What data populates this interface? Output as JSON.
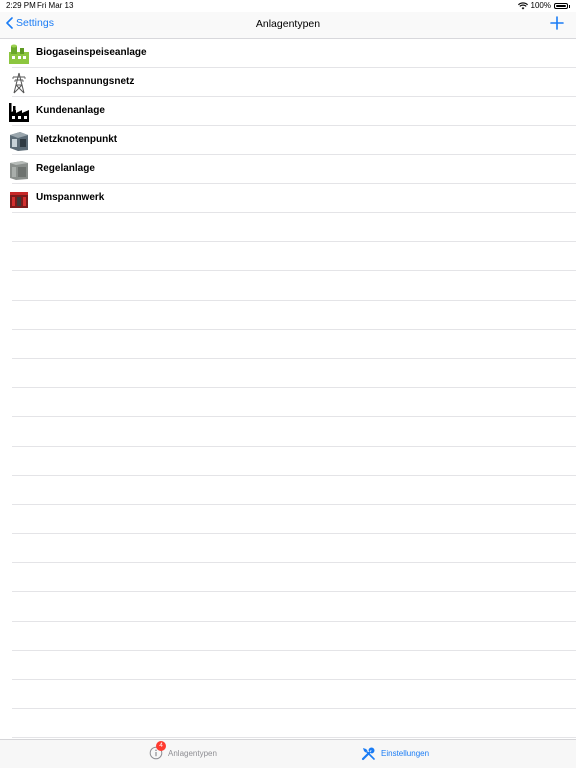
{
  "status_bar": {
    "time": "2:29 PM",
    "date": "Fri Mar 13",
    "battery": "100%"
  },
  "nav": {
    "back_label": "Settings",
    "title": "Anlagentypen"
  },
  "items": [
    {
      "label": "Biogaseinspeiseanlage",
      "icon": "biogas-plant-icon"
    },
    {
      "label": "Hochspannungsnetz",
      "icon": "power-pylon-icon"
    },
    {
      "label": "Kundenanlage",
      "icon": "factory-icon"
    },
    {
      "label": "Netzknotenpunkt",
      "icon": "network-node-icon"
    },
    {
      "label": "Regelanlage",
      "icon": "control-cabinet-icon"
    },
    {
      "label": "Umspannwerk",
      "icon": "substation-icon"
    }
  ],
  "tabs": [
    {
      "label": "Anlagentypen",
      "badge": "4",
      "icon": "info-icon"
    },
    {
      "label": "Einstellungen",
      "icon": "tools-icon"
    }
  ],
  "colors": {
    "accent": "#1a7cf5",
    "badge": "#ff3b30",
    "inactive_tab": "#8e8e93"
  }
}
